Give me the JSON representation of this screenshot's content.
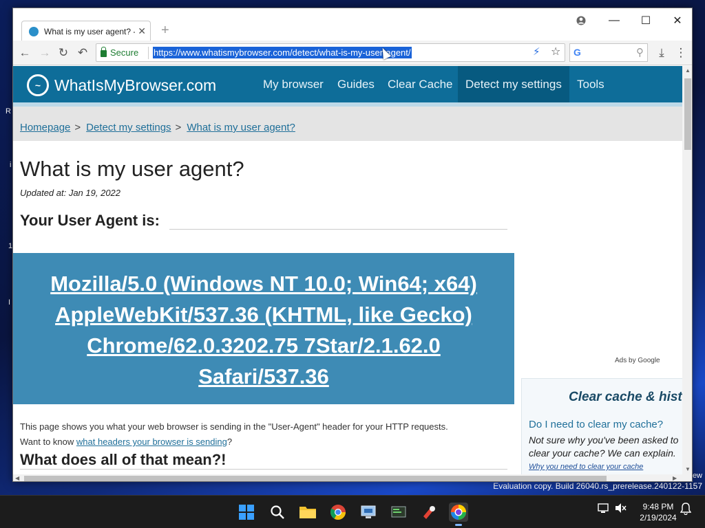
{
  "desktop": {
    "left_fragments": [
      "R",
      "i",
      "(",
      "1",
      "▇",
      "I"
    ],
    "watermark": "Evaluation copy. Build 26040.rs_prerelease.240122-1157",
    "watermark_edge": "ew"
  },
  "browser": {
    "tab_title": "What is my user agent? -",
    "secure_label": "Secure",
    "url": "https://www.whatismybrowser.com/detect/what-is-my-user-agent/"
  },
  "site": {
    "logo": "WhatIsMyBrowser.com",
    "nav": [
      "My browser",
      "Guides",
      "Clear Cache",
      "Detect my settings",
      "Tools"
    ],
    "breadcrumbs": [
      "Homepage",
      "Detect my settings",
      "What is my user agent?"
    ],
    "breadcrumb_sep": ">",
    "title": "What is my user agent?",
    "updated": "Updated at: Jan 19, 2022",
    "ua_heading": "Your User Agent is:",
    "ua_lines": [
      "Mozilla/5.0 (Windows NT 10.0; Win64; x64)",
      "AppleWebKit/537.36 (KHTML, like Gecko)",
      "Chrome/62.0.3202.75 7Star/2.1.62.0",
      "Safari/537.36"
    ],
    "para_line1": "This page shows you what your web browser is sending in the \"User-Agent\" header for your HTTP requests.",
    "para_line2_pre": "Want to know ",
    "para_link": "what headers your browser is sending",
    "para_line2_post": "?",
    "meaning_heading": "What does all of that mean?!",
    "ads_label": "Ads by Google",
    "sidebox": {
      "title": "Clear cache & hist",
      "question": "Do I need to clear my cache?",
      "answer": "Not sure why you've been asked to clear your cache? We can explain.",
      "link": "Why you need to clear your cache"
    }
  },
  "taskbar": {
    "time": "9:48 PM",
    "date": "2/19/2024"
  }
}
